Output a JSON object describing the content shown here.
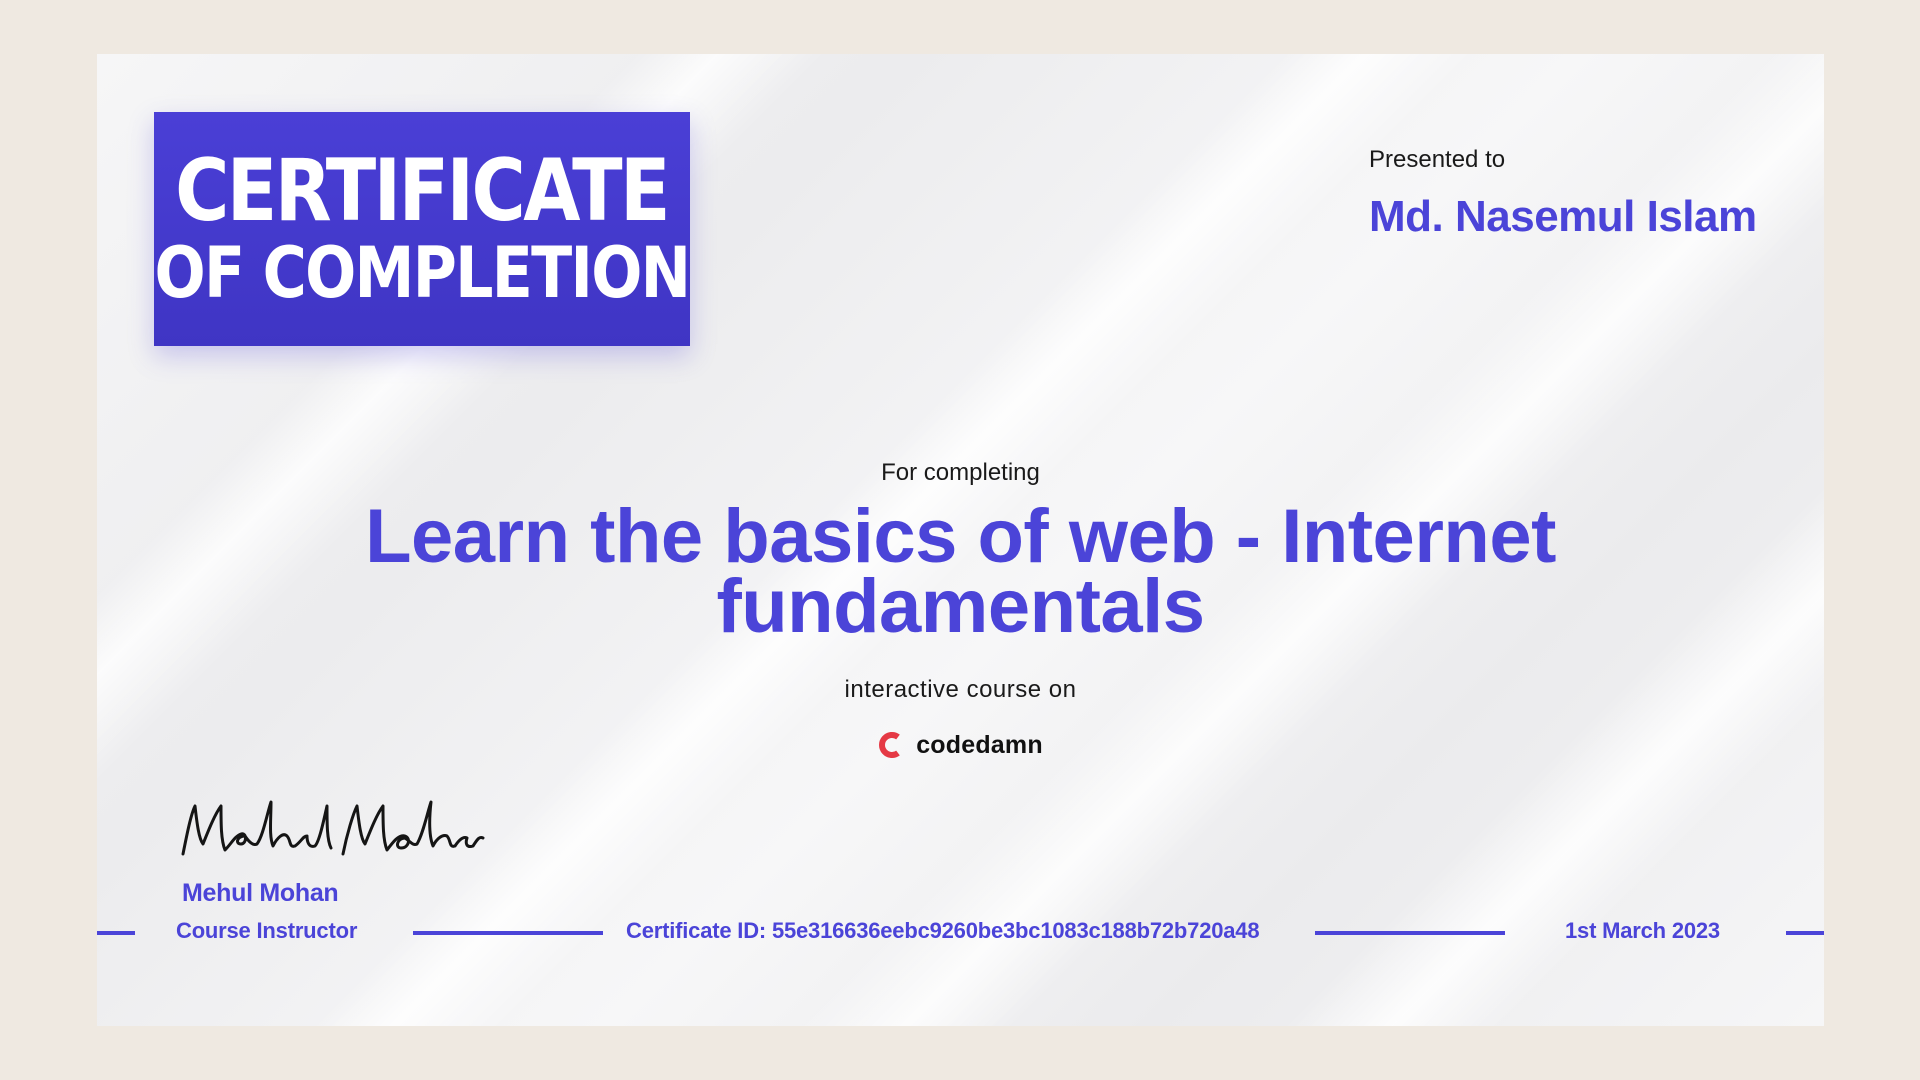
{
  "certificate": {
    "title_line1": "CERTIFICATE",
    "title_line2": "OF COMPLETION",
    "presented_label": "Presented to",
    "recipient_name": "Md. Nasemul Islam",
    "for_completing_label": "For completing",
    "course_title_line1": "Learn the basics of web - Internet",
    "course_title_line2": "fundamentals",
    "interactive_label": "interactive course on",
    "brand_name": "codedamn",
    "signature_text": "Mehul Mohan",
    "instructor_name": "Mehul Mohan",
    "instructor_role": "Course Instructor",
    "certificate_id": "Certificate ID: 55e316636eebc9260be3bc1083c188b72b720a48",
    "date": "1st March 2023"
  },
  "colors": {
    "accent": "#4b44d8",
    "title_box": "#4a3fd6",
    "brand_logo": "#e53945",
    "outer_background": "#efe9e1"
  },
  "icons": {
    "brand_logo": "codedamn-logo-icon"
  }
}
